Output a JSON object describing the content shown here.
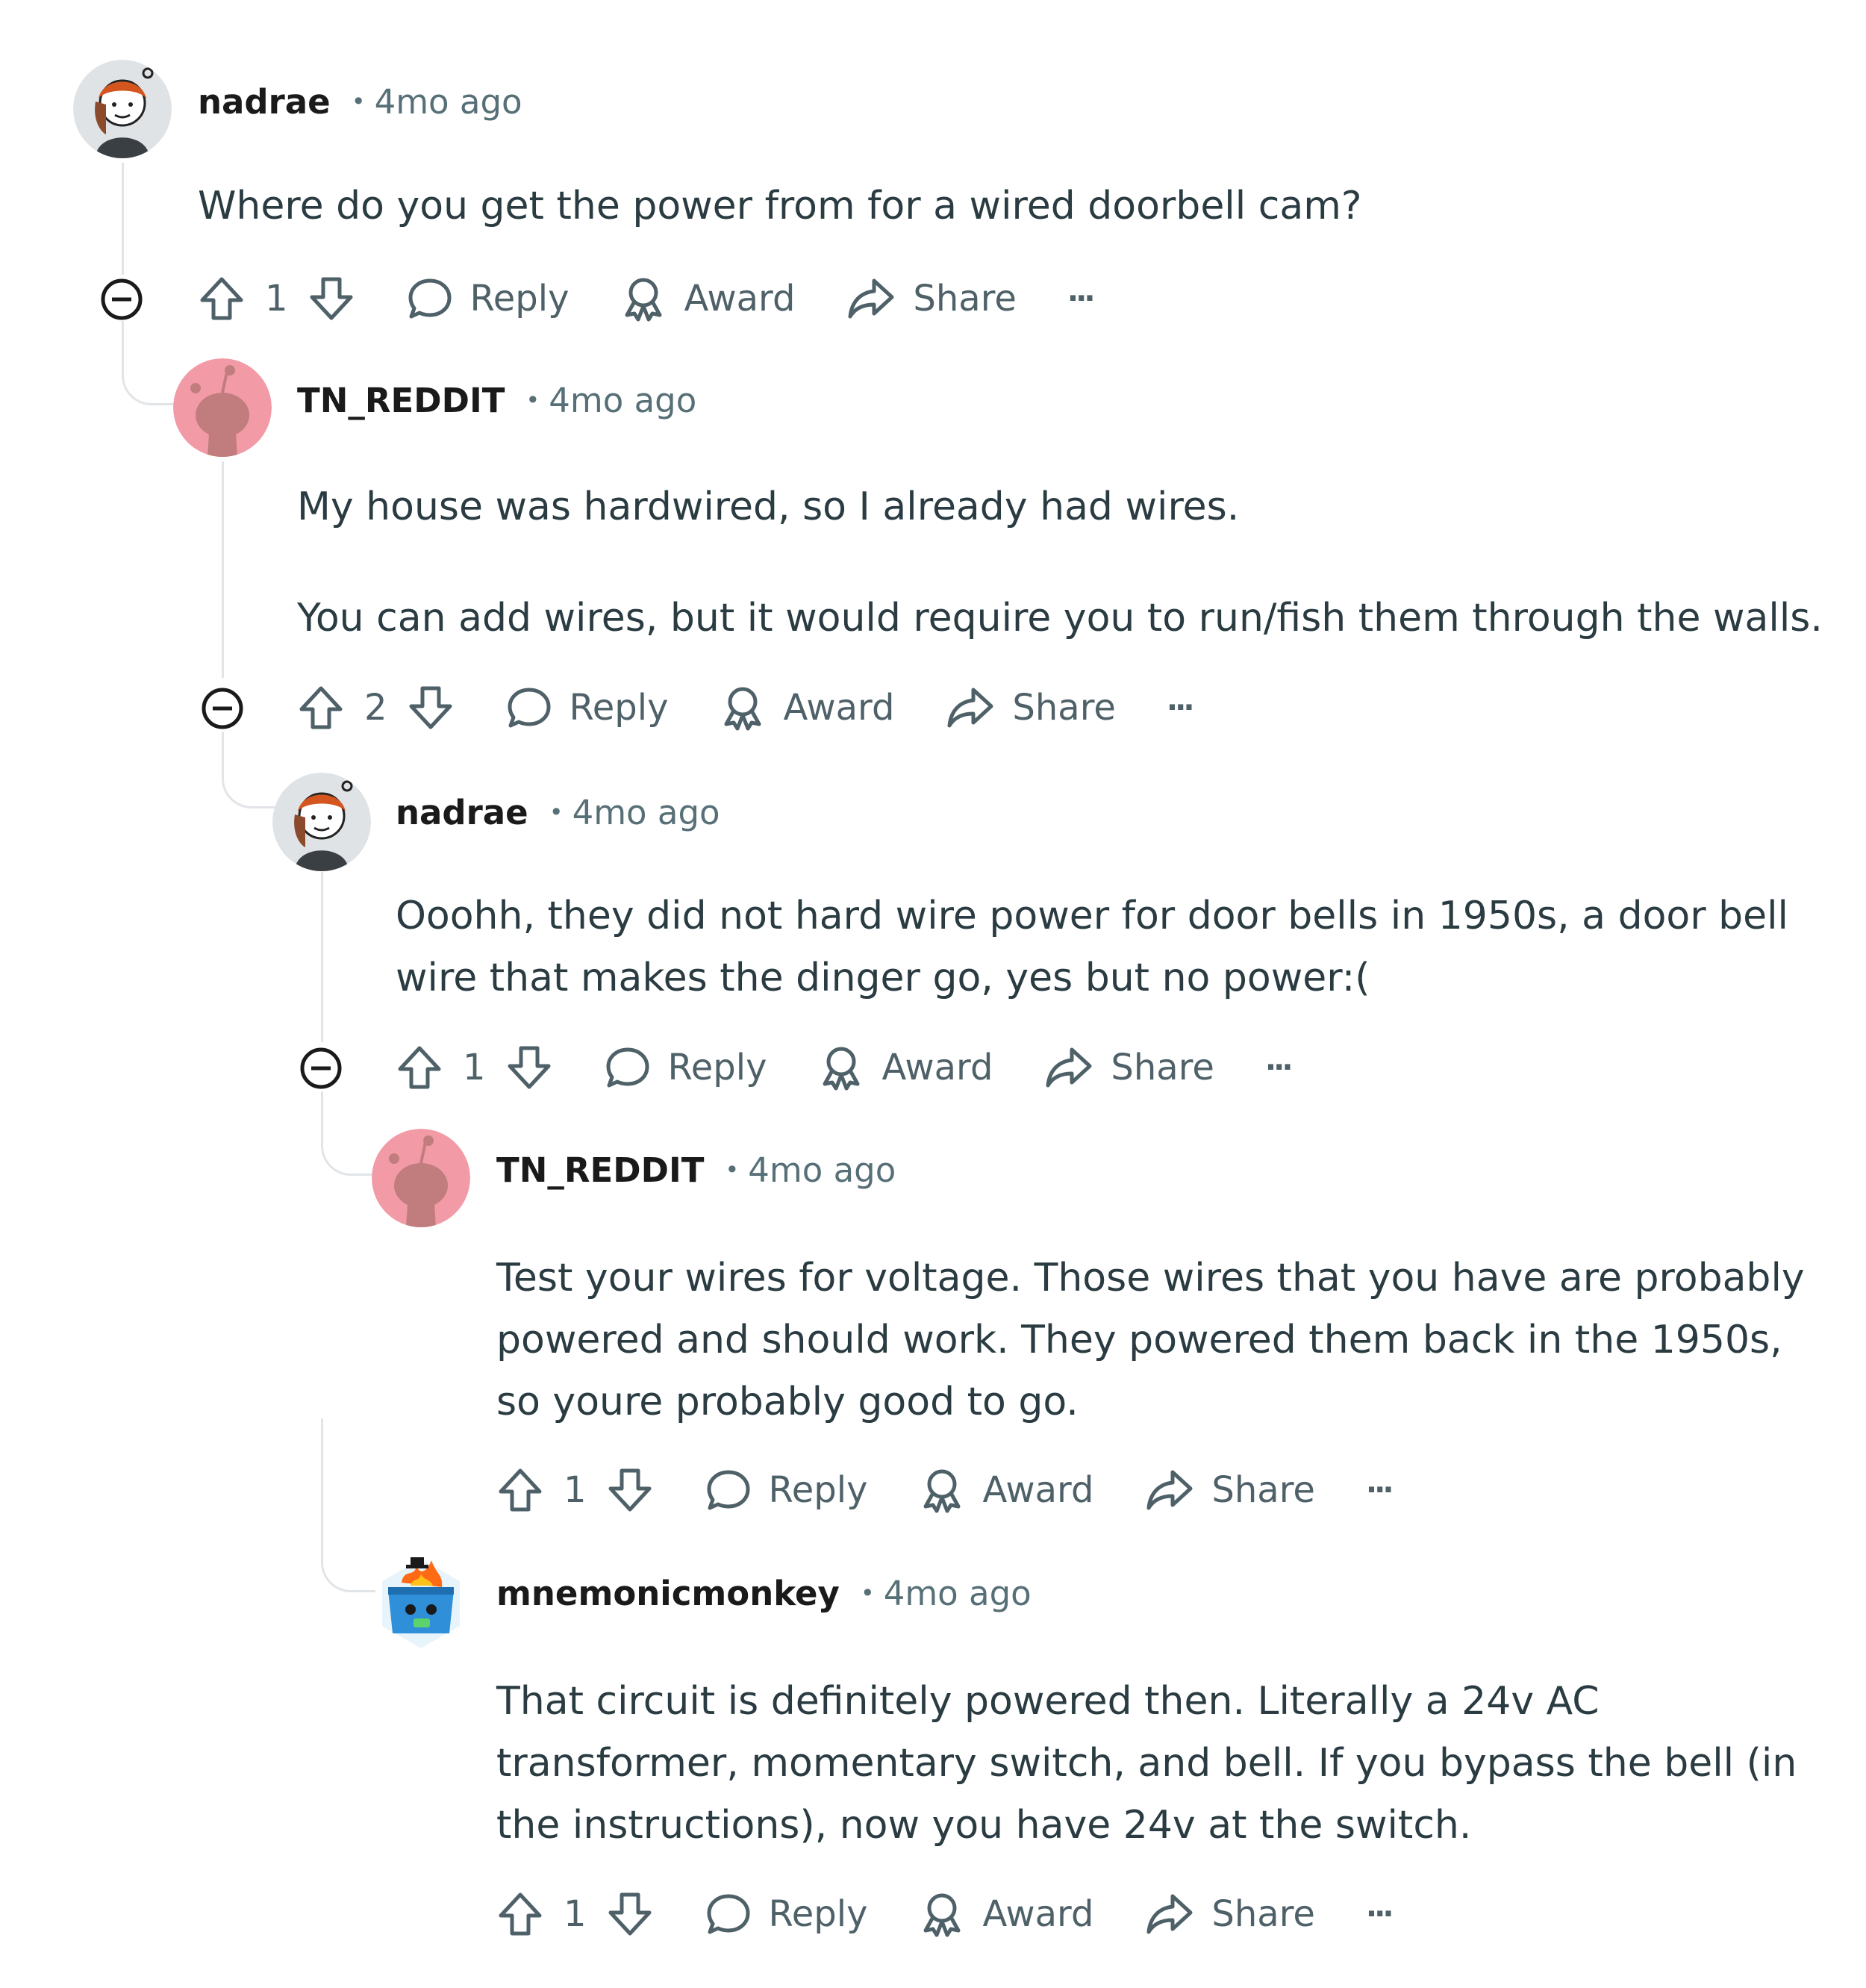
{
  "colors": {
    "thread_line": "#e2e5e8",
    "meta_text": "#576f76",
    "body_text": "#2a3c42",
    "action_text": "#4f6168",
    "snoo_bg": "#f29ba6",
    "snoo_body": "#c17d7e"
  },
  "icons": [
    "collapse-icon",
    "upvote-icon",
    "downvote-icon",
    "reply-icon",
    "award-icon",
    "share-icon",
    "more-icon"
  ],
  "comments": [
    {
      "author": "nadrae",
      "separator": "•",
      "time": "4mo ago",
      "avatar": "nadrae-avatar",
      "paragraphs": [
        "Where do you get the power from for a wired doorbell cam?"
      ],
      "score": "1",
      "reply_label": "Reply",
      "award_label": "Award",
      "share_label": "Share",
      "more_label": "···"
    },
    {
      "author": "TN_REDDIT",
      "separator": "•",
      "time": "4mo ago",
      "avatar": "snoo-avatar",
      "paragraphs": [
        "My house was hardwired, so I already had wires.",
        "You can add wires, but it would require you to run/fish them through the walls."
      ],
      "score": "2",
      "reply_label": "Reply",
      "award_label": "Award",
      "share_label": "Share",
      "more_label": "···"
    },
    {
      "author": "nadrae",
      "separator": "•",
      "time": "4mo ago",
      "avatar": "nadrae-avatar",
      "lines": [
        "Ooohh, they did not hard wire power for door bells in 1950s, a door bell",
        "wire that makes the dinger go, yes but no power:("
      ],
      "score": "1",
      "reply_label": "Reply",
      "award_label": "Award",
      "share_label": "Share",
      "more_label": "···"
    },
    {
      "author": "TN_REDDIT",
      "separator": "•",
      "time": "4mo ago",
      "avatar": "snoo-avatar",
      "lines": [
        "Test your wires for voltage. Those wires that you have are probably",
        "powered and should work. They powered them back in the 1950s,",
        "so youre probably good to go."
      ],
      "score": "1",
      "reply_label": "Reply",
      "award_label": "Award",
      "share_label": "Share",
      "more_label": "···"
    },
    {
      "author": "mnemonicmonkey",
      "separator": "•",
      "time": "4mo ago",
      "avatar": "dumpster-fire-avatar",
      "lines": [
        "That circuit is definitely powered then. Literally a 24v AC",
        "transformer, momentary switch, and bell. If you bypass the bell (in",
        "the instructions), now you have 24v at the switch."
      ],
      "score": "1",
      "reply_label": "Reply",
      "award_label": "Award",
      "share_label": "Share",
      "more_label": "···"
    }
  ]
}
